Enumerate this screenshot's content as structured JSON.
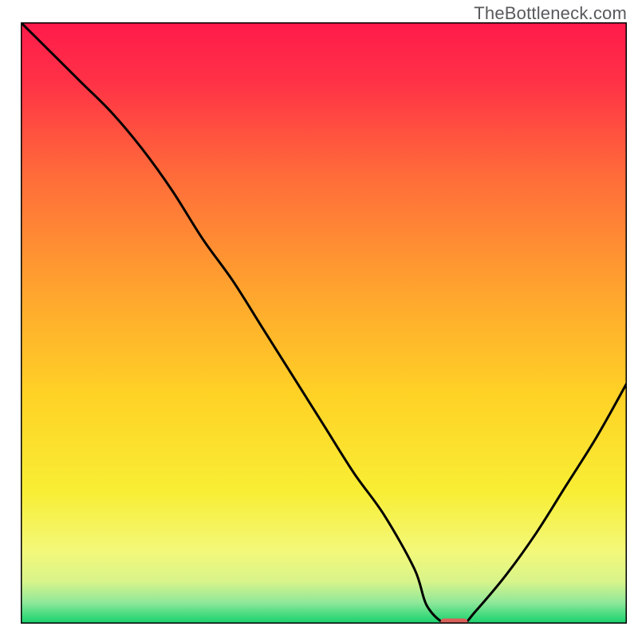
{
  "watermark": "TheBottleneck.com",
  "chart_data": {
    "type": "line",
    "title": "",
    "xlabel": "",
    "ylabel": "",
    "xlim": [
      0,
      100
    ],
    "ylim": [
      0,
      100
    ],
    "grid": false,
    "legend": false,
    "series": [
      {
        "name": "curve",
        "x": [
          0,
          5,
          10,
          15,
          20,
          25,
          30,
          35,
          40,
          45,
          50,
          55,
          60,
          65,
          67,
          70,
          73,
          75,
          80,
          85,
          90,
          95,
          100
        ],
        "y": [
          100,
          95,
          90,
          85,
          79,
          72,
          64,
          57,
          49,
          41,
          33,
          25,
          18,
          9,
          3,
          0,
          0,
          2,
          8,
          15,
          23,
          31,
          40
        ]
      }
    ],
    "marker": {
      "x_center": 71.5,
      "y_center": 0,
      "width": 4.5,
      "height": 1.2,
      "color": "#d9605a"
    },
    "background_gradient": {
      "type": "vertical",
      "stops": [
        {
          "pos": 0.0,
          "color": "#ff1a4b"
        },
        {
          "pos": 0.1,
          "color": "#ff3246"
        },
        {
          "pos": 0.25,
          "color": "#ff6a3a"
        },
        {
          "pos": 0.45,
          "color": "#ffa52e"
        },
        {
          "pos": 0.62,
          "color": "#ffd226"
        },
        {
          "pos": 0.78,
          "color": "#f8ee34"
        },
        {
          "pos": 0.88,
          "color": "#f3f87a"
        },
        {
          "pos": 0.93,
          "color": "#d8f48a"
        },
        {
          "pos": 0.965,
          "color": "#8fe79a"
        },
        {
          "pos": 0.99,
          "color": "#35d879"
        },
        {
          "pos": 1.0,
          "color": "#1ccf6d"
        }
      ]
    },
    "frame_color": "#000000",
    "frame_stroke": 3,
    "curve_color": "#000000",
    "curve_stroke": 3
  }
}
